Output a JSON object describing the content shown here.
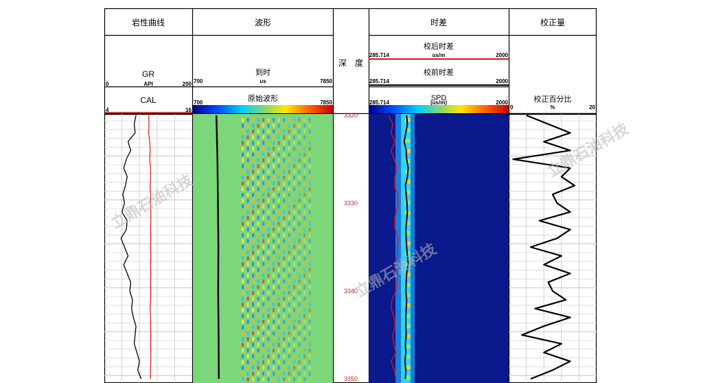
{
  "tracks": {
    "lithology": {
      "title": "岩性曲线"
    },
    "waveform": {
      "title": "波形"
    },
    "depth": {
      "title": "深　度"
    },
    "slowness": {
      "title": "时差"
    },
    "correction": {
      "title": "校正量"
    }
  },
  "headers": {
    "gr": {
      "name": "GR",
      "unit": "API",
      "min": "0",
      "max": "200"
    },
    "cal": {
      "name": "CAL",
      "min": "4",
      "max": "16"
    },
    "arrival": {
      "name": "到时",
      "unit": "us",
      "min": "700",
      "max": "7850"
    },
    "raw_wave": {
      "name": "原始波形",
      "min": "700",
      "max": "7850"
    },
    "dt_corrected": {
      "name": "校后时差",
      "unit": "us/m",
      "min": "285.714",
      "max": "2000"
    },
    "dt_raw": {
      "name": "校前时差",
      "unit": "us/m",
      "min": "285.714",
      "max": "2000"
    },
    "spd": {
      "name": "SPD",
      "unit": "(us/m)",
      "min": "285.714",
      "max": "2000"
    },
    "corr_pct": {
      "name": "校正百分比",
      "unit": "%",
      "min": "0",
      "max": "20"
    }
  },
  "watermark": "立鼎石油科技",
  "colors": {
    "grid": "#c8c8c8",
    "border": "#000000",
    "depth_text": "#d42020",
    "red_curve": "#e01010",
    "wave_bg": "#7cd67a",
    "spd_bg": "#0a1a8c"
  },
  "chart_data": {
    "type": "well-log",
    "depth_axis": {
      "ticks": [
        3320,
        3330,
        3340,
        3350
      ],
      "range": [
        3320,
        3350
      ]
    },
    "gr": {
      "scale": [
        0,
        200
      ],
      "depth": [
        3320,
        3321,
        3322,
        3323,
        3324,
        3325,
        3326,
        3327,
        3328,
        3329,
        3330,
        3331,
        3332,
        3333,
        3334,
        3335,
        3336,
        3337,
        3338,
        3339,
        3340,
        3341,
        3342,
        3343,
        3344,
        3345,
        3346,
        3347,
        3348,
        3349,
        3350
      ],
      "values": [
        72,
        68,
        70,
        54,
        60,
        50,
        44,
        52,
        48,
        42,
        46,
        40,
        52,
        50,
        38,
        46,
        54,
        44,
        52,
        60,
        58,
        64,
        62,
        66,
        72,
        70,
        68,
        74,
        80,
        76,
        84
      ]
    },
    "cal": {
      "scale": [
        4,
        16
      ],
      "depth": [
        3320,
        3321,
        3322,
        3323,
        3324,
        3325,
        3326,
        3327,
        3328,
        3329,
        3330,
        3331,
        3332,
        3333,
        3334,
        3335,
        3336,
        3337,
        3338,
        3339,
        3340,
        3341,
        3342,
        3343,
        3344,
        3345,
        3346,
        3347,
        3348,
        3349,
        3350
      ],
      "values": [
        10.05,
        10.1,
        10.05,
        10.2,
        10.25,
        10.2,
        10.3,
        10.3,
        10.25,
        10.3,
        10.3,
        10.35,
        10.35,
        10.3,
        10.35,
        10.3,
        10.35,
        10.3,
        10.35,
        10.3,
        10.35,
        10.3,
        10.25,
        10.3,
        10.3,
        10.35,
        10.3,
        10.35,
        10.35,
        10.3,
        10.3
      ]
    },
    "arrival": {
      "scale": [
        700,
        7850
      ],
      "depth": [
        3320,
        3325,
        3330,
        3335,
        3340,
        3345,
        3350
      ],
      "values": [
        1900,
        1950,
        1980,
        2000,
        1990,
        2010,
        2020
      ]
    },
    "dt_corrected": {
      "scale": [
        285.714,
        2000
      ],
      "depth": [
        3320,
        3321,
        3322,
        3323,
        3324,
        3325,
        3326,
        3327,
        3328,
        3329,
        3330,
        3331,
        3332,
        3333,
        3334,
        3335,
        3336,
        3337,
        3338,
        3339,
        3340,
        3341,
        3342,
        3343,
        3344,
        3345,
        3346,
        3347,
        3348,
        3349,
        3350
      ],
      "values": [
        750,
        760,
        740,
        720,
        745,
        750,
        770,
        760,
        735,
        745,
        755,
        760,
        750,
        740,
        745,
        750,
        760,
        770,
        750,
        745,
        740,
        750,
        745,
        740,
        740,
        745,
        735,
        740,
        730,
        740,
        735
      ]
    },
    "dt_raw": {
      "scale": [
        285.714,
        2000
      ],
      "depth": [
        3320,
        3321,
        3322,
        3323,
        3324,
        3325,
        3326,
        3327,
        3328,
        3329,
        3330,
        3331,
        3332,
        3333,
        3334,
        3335,
        3336,
        3337,
        3338,
        3339,
        3340,
        3341,
        3342,
        3343,
        3344,
        3345,
        3346,
        3347,
        3348,
        3349,
        3350
      ],
      "values": [
        530,
        580,
        560,
        610,
        560,
        600,
        630,
        610,
        600,
        640,
        650,
        620,
        600,
        610,
        650,
        640,
        640,
        600,
        640,
        630,
        620,
        570,
        560,
        600,
        610,
        580,
        590,
        620,
        560,
        600,
        620
      ]
    },
    "corr_pct": {
      "scale": [
        0,
        20
      ],
      "depth": [
        3320,
        3321,
        3322,
        3323,
        3324,
        3325,
        3326,
        3327,
        3328,
        3329,
        3330,
        3331,
        3332,
        3333,
        3334,
        3335,
        3336,
        3337,
        3338,
        3339,
        3340,
        3341,
        3342,
        3343,
        3344,
        3345,
        3346,
        3347,
        3348,
        3349,
        3350
      ],
      "values": [
        4,
        9,
        14,
        8,
        14,
        1,
        14,
        12,
        15,
        10,
        11,
        14,
        7,
        14,
        11,
        5,
        12,
        8,
        14,
        9,
        10,
        13,
        6,
        14,
        8,
        3,
        12,
        8,
        14,
        10,
        5
      ]
    }
  }
}
